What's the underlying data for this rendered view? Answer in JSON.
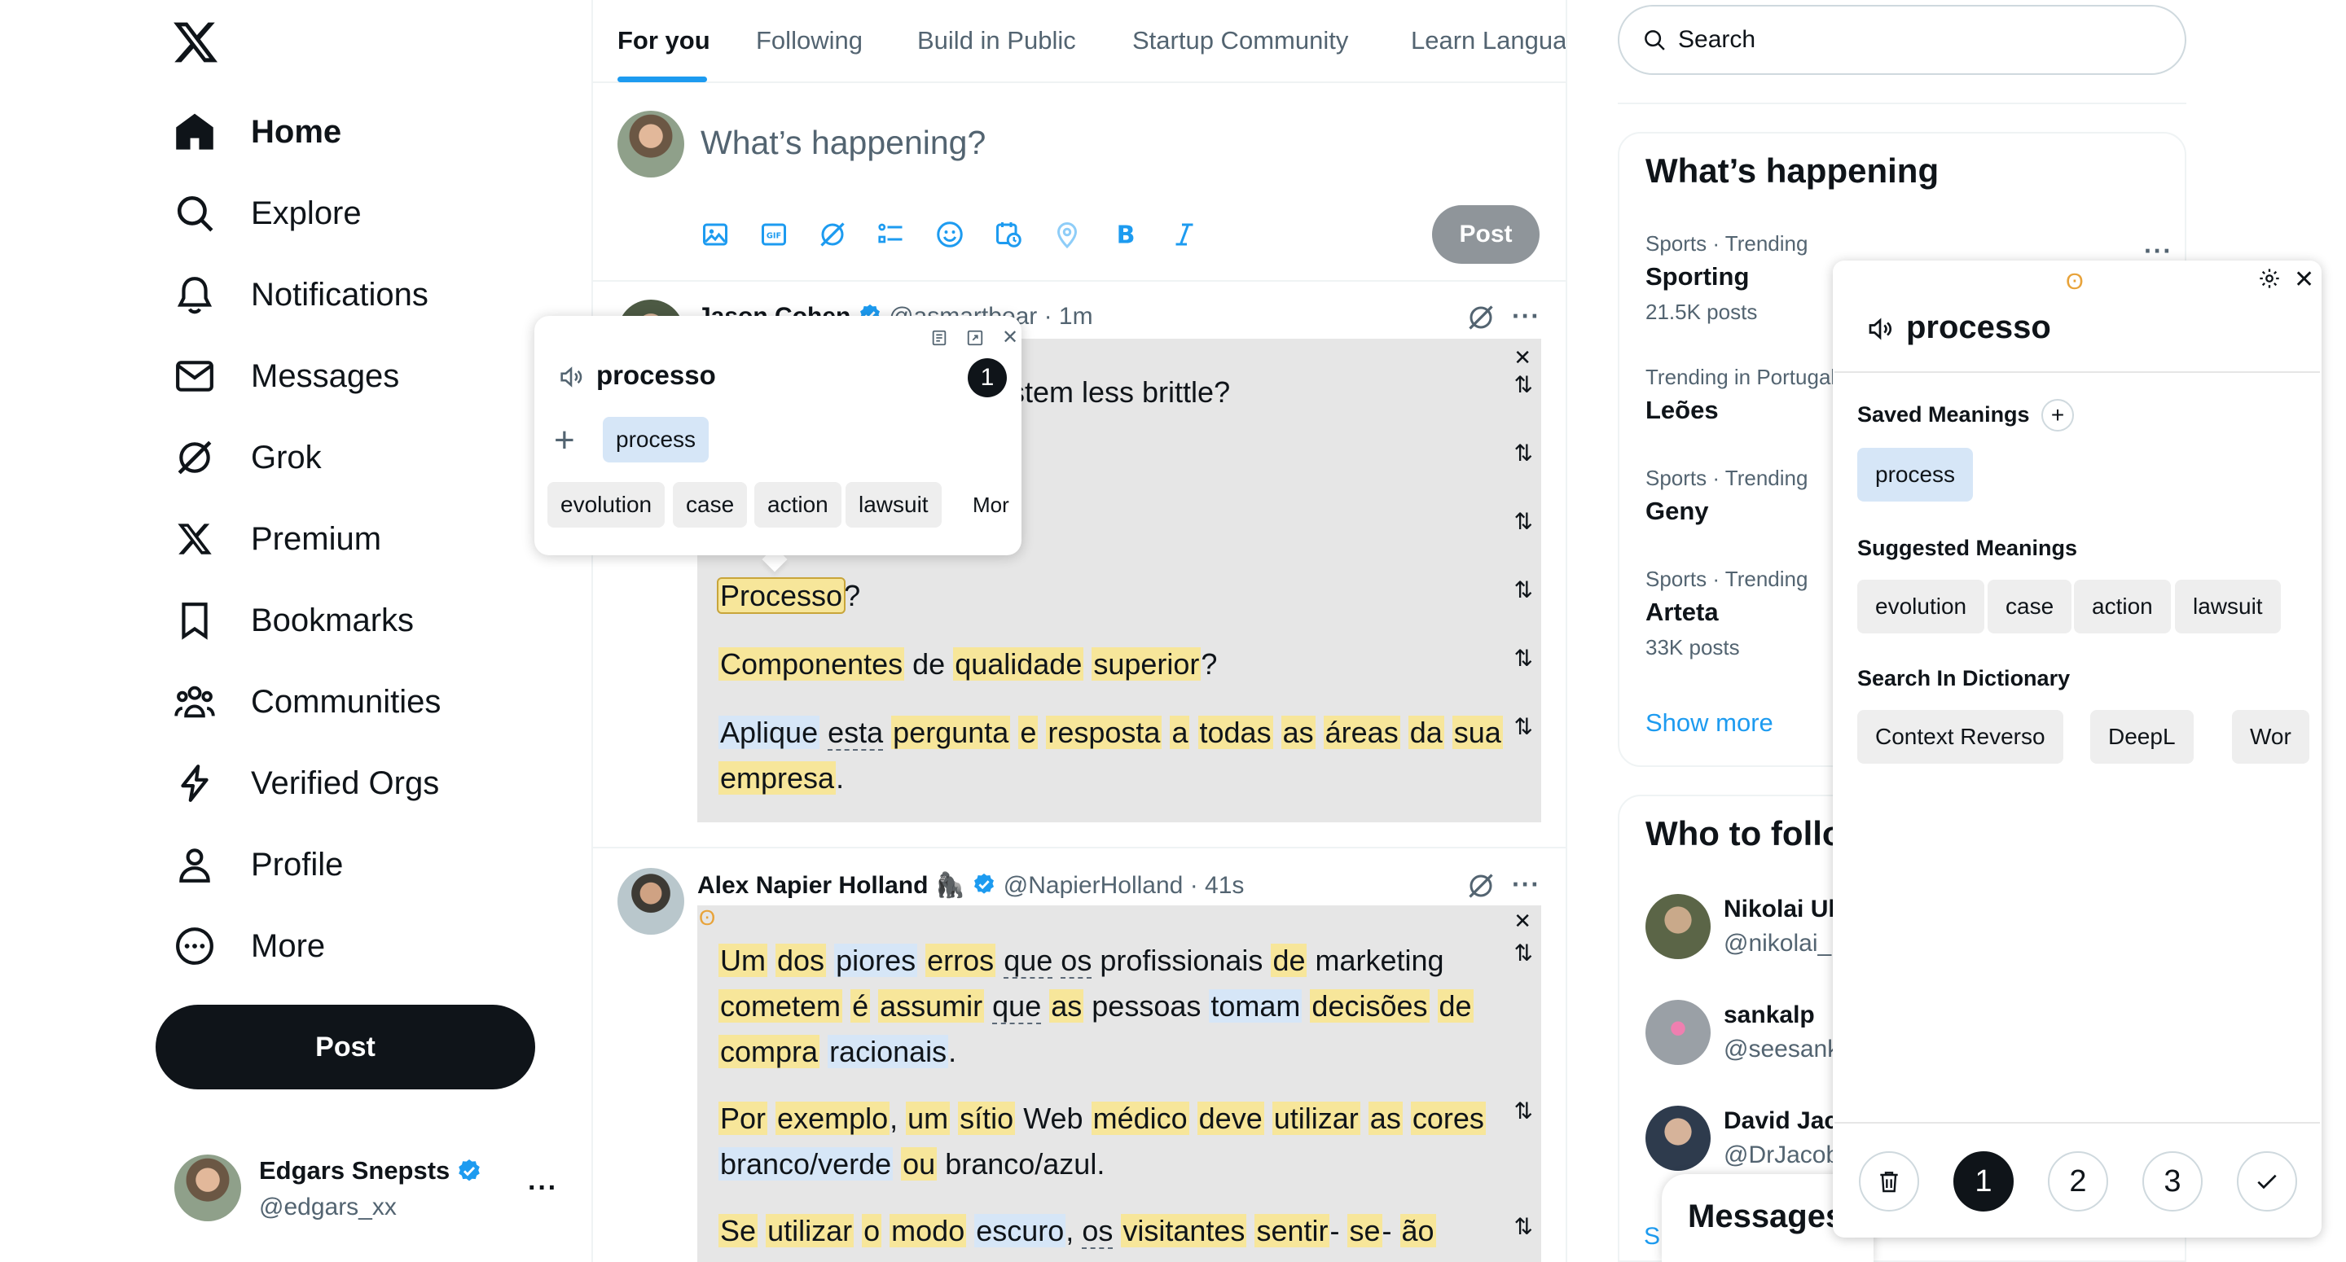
{
  "nav": {
    "items": [
      {
        "label": "Home",
        "icon": "home-icon",
        "active": true
      },
      {
        "label": "Explore",
        "icon": "search-icon"
      },
      {
        "label": "Notifications",
        "icon": "bell-icon"
      },
      {
        "label": "Messages",
        "icon": "envelope-icon"
      },
      {
        "label": "Grok",
        "icon": "grok-icon"
      },
      {
        "label": "Premium",
        "icon": "x-icon"
      },
      {
        "label": "Bookmarks",
        "icon": "bookmark-icon"
      },
      {
        "label": "Communities",
        "icon": "people-icon"
      },
      {
        "label": "Verified Orgs",
        "icon": "lightning-icon"
      },
      {
        "label": "Profile",
        "icon": "person-icon"
      },
      {
        "label": "More",
        "icon": "more-circle-icon"
      }
    ],
    "post_label": "Post"
  },
  "account": {
    "name": "Edgars Snepsts",
    "handle": "@edgars_xx",
    "more": "···"
  },
  "tabs": [
    "For you",
    "Following",
    "Build in Public",
    "Startup Community",
    "Learn Langua"
  ],
  "compose": {
    "placeholder": "What’s happening?",
    "post_label": "Post"
  },
  "tweet1": {
    "name": "Jason Cohen",
    "handle": "@asmartbear · 1m",
    "lines": {
      "l1": "stem less brittle?",
      "l4_word": "Processo",
      "l4_end": "?",
      "l5": [
        "Componentes",
        " de ",
        "qualidade",
        " ",
        "superior",
        "?"
      ],
      "l6": [
        "Aplique",
        " ",
        "esta",
        " ",
        "pergunta",
        " ",
        "e",
        " ",
        "resposta",
        " ",
        "a",
        " ",
        "todas",
        " ",
        "as",
        " ",
        "áreas",
        " ",
        "da",
        " ",
        "sua"
      ],
      "l7": [
        "empresa",
        "."
      ]
    }
  },
  "tweet2": {
    "name": "Alex Napier Holland",
    "emoji": "🦍",
    "handle": "@NapierHolland · 41s",
    "p1a": [
      "Um",
      " ",
      "dos",
      " ",
      "piores",
      " ",
      "erros",
      " ",
      "que",
      " ",
      "os",
      " profissionais ",
      "de",
      " marketing"
    ],
    "p1b": [
      "cometem",
      " ",
      "é",
      " ",
      "assumir",
      " ",
      "que",
      " ",
      "as",
      " pessoas ",
      "tomam",
      " ",
      "decisões",
      " ",
      "de"
    ],
    "p1c": [
      "compra",
      " ",
      "racionais",
      "."
    ],
    "p2a": [
      "Por",
      " ",
      "exemplo",
      ", ",
      "um",
      " ",
      "sítio",
      " Web ",
      "médico",
      " ",
      "deve",
      " ",
      "utilizar",
      " ",
      "as",
      " ",
      "cores"
    ],
    "p2b": [
      "branco/verde",
      " ",
      "ou",
      " branco/azul."
    ],
    "p3a": [
      "Se",
      " ",
      "utilizar",
      " ",
      "o",
      " ",
      "modo",
      " ",
      "escuro",
      ", ",
      "os",
      " ",
      "visitantes",
      " ",
      "sentir",
      "- ",
      "se",
      "- ",
      "ão"
    ]
  },
  "search": {
    "placeholder": "Search"
  },
  "trends": {
    "title": "What’s happening",
    "items": [
      {
        "meta": "Sports · Trending",
        "name": "Sporting",
        "posts": "21.5K posts"
      },
      {
        "meta": "Trending in Portugal",
        "name": "Leões",
        "posts": ""
      },
      {
        "meta": "Sports · Trending",
        "name": "Geny",
        "posts": ""
      },
      {
        "meta": "Sports · Trending",
        "name": "Arteta",
        "posts": "33K posts"
      }
    ],
    "show_more": "Show more",
    "more": "···"
  },
  "who": {
    "title": "Who to follow",
    "items": [
      {
        "name": "Nikolai Ul",
        "handle": "@nikolai_"
      },
      {
        "name": "sankalp",
        "handle": "@seesank"
      },
      {
        "name": "David Jac",
        "handle": "@DrJacob"
      }
    ]
  },
  "messages": {
    "title": "Messages",
    "s": "S"
  },
  "dict_panel": {
    "word": "processo",
    "saved_label": "Saved Meanings",
    "saved": [
      "process"
    ],
    "suggested_label": "Suggested Meanings",
    "suggested": [
      "evolution",
      "case",
      "action",
      "lawsuit"
    ],
    "dict_label": "Search In Dictionary",
    "dicts": [
      "Context Reverso",
      "DeepL",
      "Wor"
    ],
    "pages": [
      "1",
      "2",
      "3"
    ]
  },
  "popup": {
    "word": "processo",
    "badge": "1",
    "saved": "process",
    "chips": [
      "evolution",
      "case",
      "action",
      "lawsuit",
      "Mor"
    ]
  }
}
